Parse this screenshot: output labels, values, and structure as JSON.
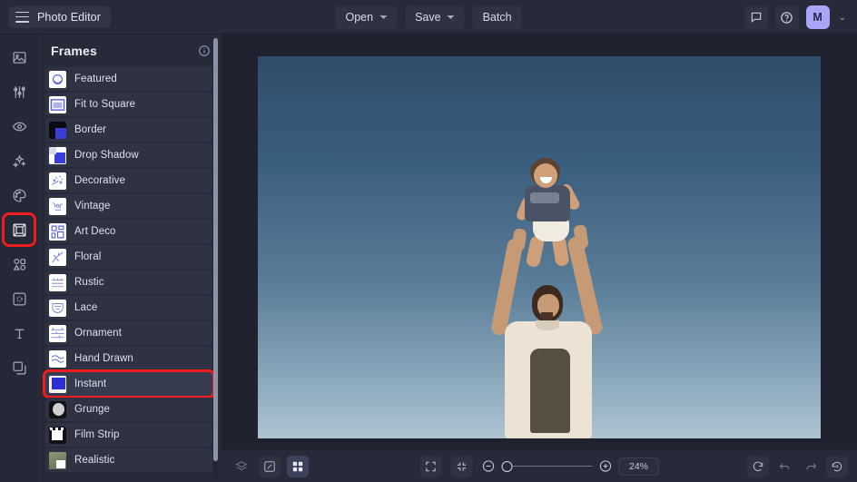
{
  "app": {
    "title": "Photo Editor",
    "menu_icon": "hamburger-icon"
  },
  "toolbar": {
    "open_label": "Open",
    "save_label": "Save",
    "batch_label": "Batch",
    "feedback_icon": "comment-icon",
    "help_icon": "help-circle-icon",
    "avatar_initial": "M",
    "avatar_color": "#a9a5f7",
    "account_chevron": "chevron-down-icon"
  },
  "rail": {
    "items": [
      {
        "icon": "image-adjust-icon",
        "name": "image-tools",
        "selected": false
      },
      {
        "icon": "sliders-icon",
        "name": "adjustments",
        "selected": false
      },
      {
        "icon": "eye-icon",
        "name": "retouch",
        "selected": false
      },
      {
        "icon": "sparkles-icon",
        "name": "effects",
        "selected": false
      },
      {
        "icon": "palette-icon",
        "name": "colors",
        "selected": false
      },
      {
        "icon": "frame-icon",
        "name": "frames",
        "selected": true
      },
      {
        "icon": "shapes-icon",
        "name": "shapes",
        "selected": false
      },
      {
        "icon": "sticker-icon",
        "name": "stickers",
        "selected": false
      },
      {
        "icon": "text-icon",
        "name": "text",
        "selected": false
      },
      {
        "icon": "layers-copy-icon",
        "name": "overlays",
        "selected": false
      }
    ],
    "selection_color": "#ee1d1d"
  },
  "panel": {
    "title": "Frames",
    "info_icon": "info-circle-icon",
    "items": [
      {
        "label": "Featured",
        "selected": false
      },
      {
        "label": "Fit to Square",
        "selected": false
      },
      {
        "label": "Border",
        "selected": false
      },
      {
        "label": "Drop Shadow",
        "selected": false
      },
      {
        "label": "Decorative",
        "selected": false
      },
      {
        "label": "Vintage",
        "selected": false
      },
      {
        "label": "Art Deco",
        "selected": false
      },
      {
        "label": "Floral",
        "selected": false
      },
      {
        "label": "Rustic",
        "selected": false
      },
      {
        "label": "Lace",
        "selected": false
      },
      {
        "label": "Ornament",
        "selected": false
      },
      {
        "label": "Hand Drawn",
        "selected": false
      },
      {
        "label": "Instant",
        "selected": true
      },
      {
        "label": "Grunge",
        "selected": false
      },
      {
        "label": "Film Strip",
        "selected": false
      },
      {
        "label": "Realistic",
        "selected": false
      }
    ],
    "selection_color": "#ee1d1d"
  },
  "canvas": {
    "image_description": "Man in white graphic t-shirt with arms raised tossing a laughing baby in a diaper against a blue sky"
  },
  "bottombar": {
    "layers_icon": "layers-icon",
    "compare_icon": "compare-icon",
    "grid_icon": "grid-icon",
    "fit_icon": "fit-screen-icon",
    "shrink_icon": "collapse-icon",
    "zoom_out_icon": "minus-circle-icon",
    "zoom_in_icon": "plus-circle-icon",
    "zoom_level": "24%",
    "reset_icon": "reset-icon",
    "undo_icon": "undo-icon",
    "redo_icon": "redo-icon",
    "history_icon": "history-icon"
  }
}
